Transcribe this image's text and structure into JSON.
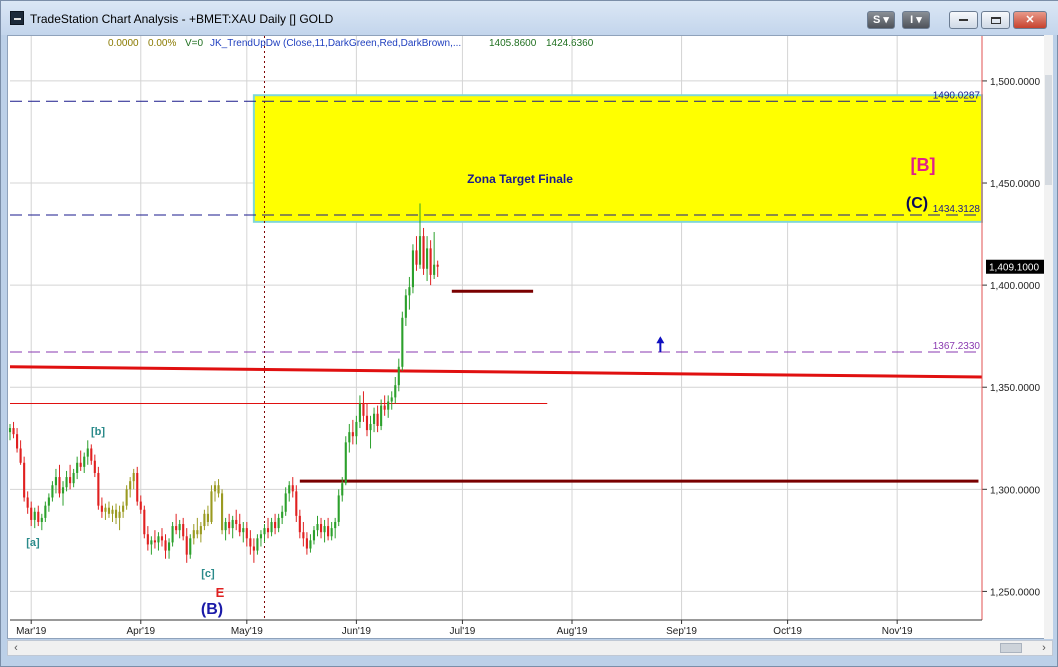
{
  "window": {
    "title": "TradeStation Chart Analysis - +BMET:XAU Daily [] GOLD",
    "buttons": {
      "s_label": "S ▾",
      "i_label": "I ▾"
    }
  },
  "indicator": {
    "v1": "0.0000",
    "v2": "0.00%",
    "v3": "V=0",
    "name": "JK_TrendUpDw (Close,11,DarkGreen,Red,DarkBrown,...",
    "v4": "1405.8600",
    "v5": "1424.6360",
    "colors": {
      "v1": "#8a7a00",
      "v3": "#1f6f1f",
      "name": "#1f3fbf",
      "values": "#1f6f1f"
    }
  },
  "annotations": {
    "zone_label": "Zona Target Finale",
    "wave_B_bracket": "[B]",
    "wave_C": "(C)",
    "wave_b": "[b]",
    "wave_a": "[a]",
    "wave_c": "[c]",
    "wave_E": "E",
    "wave_B": "(B)"
  },
  "colors": {
    "zone_fill": "#ffff00",
    "zone_border": "#7fd7d7",
    "trend_red": "#e01010",
    "support_brown": "#7a0000",
    "dash_navy": "#1a1a8c",
    "dash_purple": "#8a3ab0",
    "bull": "#2ca02c",
    "bear": "#e02020",
    "neutral": "#9a9a20",
    "arrow": "#1010c0"
  },
  "chart_data": {
    "type": "candlestick",
    "symbol": "+BMET:XAU",
    "interval": "Daily",
    "ylim": [
      1236,
      1522
    ],
    "y_ticks": [
      "1,500.0000",
      "1,450.0000",
      "1,400.0000",
      "1,350.0000",
      "1,300.0000",
      "1,250.0000"
    ],
    "y_tick_values": [
      1500,
      1450,
      1400,
      1350,
      1300,
      1250
    ],
    "x_labels": [
      "Mar'19",
      "Apr'19",
      "May'19",
      "Jun'19",
      "Jul'19",
      "Aug'19",
      "Sep'19",
      "Oct'19",
      "Nov'19"
    ],
    "x_label_days": [
      0,
      31,
      61,
      92,
      122,
      153,
      184,
      214,
      245
    ],
    "x_range_days": [
      -6,
      269
    ],
    "last_price": "1,409.1000",
    "levels": [
      {
        "name": "upper",
        "label": "1490.0287",
        "value": 1490.0287
      },
      {
        "name": "lower",
        "label": "1434.3128",
        "value": 1434.3128
      },
      {
        "name": "pivot",
        "label": "1367.2330",
        "value": 1367.233
      }
    ],
    "target_zone": {
      "low": 1431,
      "high": 1493,
      "start_day": 63,
      "label": "Zona Target Finale"
    },
    "trendline": {
      "start_day": -6,
      "start_value": 1360,
      "end_day": 269,
      "end_value": 1355
    },
    "thin_red_line": {
      "value": 1342,
      "start_day": -6,
      "end_day": 146
    },
    "support_high": {
      "value": 1304,
      "start_day": 76,
      "end_day": 268
    },
    "support_short": {
      "value": 1397,
      "start_day": 119,
      "end_day": 142
    },
    "vertical_marker_day": 66,
    "arrow": {
      "day": 178,
      "value": 1374
    },
    "candles": [
      {
        "d": -6,
        "o": 1328,
        "h": 1332,
        "l": 1324,
        "c": 1330
      },
      {
        "d": -5,
        "o": 1330,
        "h": 1333,
        "l": 1325,
        "c": 1327
      },
      {
        "d": -4,
        "o": 1327,
        "h": 1330,
        "l": 1318,
        "c": 1320
      },
      {
        "d": -3,
        "o": 1320,
        "h": 1324,
        "l": 1312,
        "c": 1313
      },
      {
        "d": -2,
        "o": 1313,
        "h": 1316,
        "l": 1294,
        "c": 1296
      },
      {
        "d": -1,
        "o": 1296,
        "h": 1299,
        "l": 1288,
        "c": 1291
      },
      {
        "d": 0,
        "o": 1291,
        "h": 1294,
        "l": 1282,
        "c": 1285
      },
      {
        "d": 1,
        "o": 1285,
        "h": 1291,
        "l": 1281,
        "c": 1289
      },
      {
        "d": 2,
        "o": 1289,
        "h": 1292,
        "l": 1282,
        "c": 1284
      },
      {
        "d": 3,
        "o": 1284,
        "h": 1288,
        "l": 1280,
        "c": 1286
      },
      {
        "d": 4,
        "o": 1286,
        "h": 1294,
        "l": 1284,
        "c": 1292
      },
      {
        "d": 5,
        "o": 1292,
        "h": 1298,
        "l": 1289,
        "c": 1296
      },
      {
        "d": 6,
        "o": 1296,
        "h": 1304,
        "l": 1294,
        "c": 1302
      },
      {
        "d": 7,
        "o": 1302,
        "h": 1310,
        "l": 1298,
        "c": 1306
      },
      {
        "d": 8,
        "o": 1306,
        "h": 1312,
        "l": 1296,
        "c": 1298
      },
      {
        "d": 9,
        "o": 1298,
        "h": 1304,
        "l": 1292,
        "c": 1301
      },
      {
        "d": 10,
        "o": 1301,
        "h": 1309,
        "l": 1299,
        "c": 1306
      },
      {
        "d": 11,
        "o": 1306,
        "h": 1312,
        "l": 1300,
        "c": 1303
      },
      {
        "d": 12,
        "o": 1303,
        "h": 1310,
        "l": 1301,
        "c": 1308
      },
      {
        "d": 13,
        "o": 1308,
        "h": 1316,
        "l": 1305,
        "c": 1313
      },
      {
        "d": 14,
        "o": 1313,
        "h": 1319,
        "l": 1309,
        "c": 1311
      },
      {
        "d": 15,
        "o": 1311,
        "h": 1318,
        "l": 1308,
        "c": 1316
      },
      {
        "d": 16,
        "o": 1316,
        "h": 1324,
        "l": 1312,
        "c": 1320
      },
      {
        "d": 17,
        "o": 1320,
        "h": 1322,
        "l": 1312,
        "c": 1314
      },
      {
        "d": 18,
        "o": 1314,
        "h": 1317,
        "l": 1306,
        "c": 1308
      },
      {
        "d": 19,
        "o": 1308,
        "h": 1311,
        "l": 1290,
        "c": 1292
      },
      {
        "d": 20,
        "o": 1292,
        "h": 1296,
        "l": 1286,
        "c": 1289
      },
      {
        "d": 21,
        "o": 1289,
        "h": 1293,
        "l": 1285,
        "c": 1291
      },
      {
        "d": 22,
        "o": 1291,
        "h": 1294,
        "l": 1286,
        "c": 1288
      },
      {
        "d": 23,
        "o": 1288,
        "h": 1292,
        "l": 1284,
        "c": 1290
      },
      {
        "d": 24,
        "o": 1290,
        "h": 1293,
        "l": 1283,
        "c": 1286
      },
      {
        "d": 25,
        "o": 1286,
        "h": 1292,
        "l": 1280,
        "c": 1289
      },
      {
        "d": 26,
        "o": 1289,
        "h": 1294,
        "l": 1286,
        "c": 1292
      },
      {
        "d": 27,
        "o": 1292,
        "h": 1302,
        "l": 1290,
        "c": 1300
      },
      {
        "d": 28,
        "o": 1300,
        "h": 1306,
        "l": 1296,
        "c": 1304
      },
      {
        "d": 29,
        "o": 1304,
        "h": 1310,
        "l": 1300,
        "c": 1308
      },
      {
        "d": 30,
        "o": 1308,
        "h": 1311,
        "l": 1292,
        "c": 1294
      },
      {
        "d": 31,
        "o": 1294,
        "h": 1297,
        "l": 1288,
        "c": 1290
      },
      {
        "d": 32,
        "o": 1290,
        "h": 1292,
        "l": 1276,
        "c": 1278
      },
      {
        "d": 33,
        "o": 1278,
        "h": 1282,
        "l": 1270,
        "c": 1273
      },
      {
        "d": 34,
        "o": 1273,
        "h": 1277,
        "l": 1268,
        "c": 1275
      },
      {
        "d": 35,
        "o": 1275,
        "h": 1280,
        "l": 1271,
        "c": 1274
      },
      {
        "d": 36,
        "o": 1274,
        "h": 1279,
        "l": 1270,
        "c": 1277
      },
      {
        "d": 37,
        "o": 1277,
        "h": 1281,
        "l": 1272,
        "c": 1275
      },
      {
        "d": 38,
        "o": 1275,
        "h": 1278,
        "l": 1266,
        "c": 1270
      },
      {
        "d": 39,
        "o": 1270,
        "h": 1276,
        "l": 1266,
        "c": 1274
      },
      {
        "d": 40,
        "o": 1274,
        "h": 1284,
        "l": 1272,
        "c": 1282
      },
      {
        "d": 41,
        "o": 1282,
        "h": 1288,
        "l": 1278,
        "c": 1280
      },
      {
        "d": 42,
        "o": 1280,
        "h": 1285,
        "l": 1276,
        "c": 1283
      },
      {
        "d": 43,
        "o": 1283,
        "h": 1286,
        "l": 1275,
        "c": 1277
      },
      {
        "d": 44,
        "o": 1277,
        "h": 1281,
        "l": 1264,
        "c": 1268
      },
      {
        "d": 45,
        "o": 1268,
        "h": 1278,
        "l": 1266,
        "c": 1276
      },
      {
        "d": 46,
        "o": 1276,
        "h": 1283,
        "l": 1273,
        "c": 1280
      },
      {
        "d": 47,
        "o": 1280,
        "h": 1286,
        "l": 1276,
        "c": 1278
      },
      {
        "d": 48,
        "o": 1278,
        "h": 1284,
        "l": 1274,
        "c": 1282
      },
      {
        "d": 49,
        "o": 1282,
        "h": 1290,
        "l": 1280,
        "c": 1288
      },
      {
        "d": 50,
        "o": 1288,
        "h": 1292,
        "l": 1282,
        "c": 1284
      },
      {
        "d": 51,
        "o": 1284,
        "h": 1302,
        "l": 1283,
        "c": 1299
      },
      {
        "d": 52,
        "o": 1299,
        "h": 1304,
        "l": 1294,
        "c": 1302
      },
      {
        "d": 53,
        "o": 1302,
        "h": 1305,
        "l": 1296,
        "c": 1298
      },
      {
        "d": 54,
        "o": 1298,
        "h": 1300,
        "l": 1278,
        "c": 1280
      },
      {
        "d": 55,
        "o": 1280,
        "h": 1286,
        "l": 1275,
        "c": 1284
      },
      {
        "d": 56,
        "o": 1284,
        "h": 1288,
        "l": 1278,
        "c": 1281
      },
      {
        "d": 57,
        "o": 1281,
        "h": 1287,
        "l": 1276,
        "c": 1285
      },
      {
        "d": 58,
        "o": 1285,
        "h": 1290,
        "l": 1280,
        "c": 1283
      },
      {
        "d": 59,
        "o": 1283,
        "h": 1288,
        "l": 1277,
        "c": 1279
      },
      {
        "d": 60,
        "o": 1279,
        "h": 1284,
        "l": 1274,
        "c": 1281
      },
      {
        "d": 61,
        "o": 1281,
        "h": 1284,
        "l": 1272,
        "c": 1276
      },
      {
        "d": 62,
        "o": 1276,
        "h": 1280,
        "l": 1268,
        "c": 1272
      },
      {
        "d": 63,
        "o": 1272,
        "h": 1276,
        "l": 1264,
        "c": 1270
      },
      {
        "d": 64,
        "o": 1270,
        "h": 1278,
        "l": 1268,
        "c": 1276
      },
      {
        "d": 65,
        "o": 1276,
        "h": 1280,
        "l": 1272,
        "c": 1278
      },
      {
        "d": 66,
        "o": 1278,
        "h": 1283,
        "l": 1274,
        "c": 1281
      },
      {
        "d": 67,
        "o": 1281,
        "h": 1286,
        "l": 1276,
        "c": 1279
      },
      {
        "d": 68,
        "o": 1279,
        "h": 1286,
        "l": 1277,
        "c": 1284
      },
      {
        "d": 69,
        "o": 1284,
        "h": 1288,
        "l": 1278,
        "c": 1281
      },
      {
        "d": 70,
        "o": 1281,
        "h": 1288,
        "l": 1279,
        "c": 1286
      },
      {
        "d": 71,
        "o": 1286,
        "h": 1292,
        "l": 1283,
        "c": 1289
      },
      {
        "d": 72,
        "o": 1289,
        "h": 1301,
        "l": 1287,
        "c": 1298
      },
      {
        "d": 73,
        "o": 1298,
        "h": 1304,
        "l": 1294,
        "c": 1302
      },
      {
        "d": 74,
        "o": 1302,
        "h": 1306,
        "l": 1296,
        "c": 1299
      },
      {
        "d": 75,
        "o": 1299,
        "h": 1302,
        "l": 1284,
        "c": 1287
      },
      {
        "d": 76,
        "o": 1287,
        "h": 1290,
        "l": 1276,
        "c": 1279
      },
      {
        "d": 77,
        "o": 1279,
        "h": 1284,
        "l": 1272,
        "c": 1276
      },
      {
        "d": 78,
        "o": 1276,
        "h": 1279,
        "l": 1268,
        "c": 1271
      },
      {
        "d": 79,
        "o": 1271,
        "h": 1278,
        "l": 1269,
        "c": 1275
      },
      {
        "d": 80,
        "o": 1275,
        "h": 1282,
        "l": 1273,
        "c": 1280
      },
      {
        "d": 81,
        "o": 1280,
        "h": 1287,
        "l": 1277,
        "c": 1283
      },
      {
        "d": 82,
        "o": 1283,
        "h": 1286,
        "l": 1276,
        "c": 1279
      },
      {
        "d": 83,
        "o": 1279,
        "h": 1285,
        "l": 1274,
        "c": 1282
      },
      {
        "d": 84,
        "o": 1282,
        "h": 1286,
        "l": 1275,
        "c": 1277
      },
      {
        "d": 85,
        "o": 1277,
        "h": 1284,
        "l": 1275,
        "c": 1281
      },
      {
        "d": 86,
        "o": 1281,
        "h": 1286,
        "l": 1276,
        "c": 1284
      },
      {
        "d": 87,
        "o": 1284,
        "h": 1300,
        "l": 1282,
        "c": 1297
      },
      {
        "d": 88,
        "o": 1297,
        "h": 1306,
        "l": 1294,
        "c": 1303
      },
      {
        "d": 89,
        "o": 1303,
        "h": 1326,
        "l": 1302,
        "c": 1323
      },
      {
        "d": 90,
        "o": 1323,
        "h": 1332,
        "l": 1318,
        "c": 1328
      },
      {
        "d": 91,
        "o": 1328,
        "h": 1334,
        "l": 1322,
        "c": 1326
      },
      {
        "d": 92,
        "o": 1326,
        "h": 1336,
        "l": 1322,
        "c": 1333
      },
      {
        "d": 93,
        "o": 1333,
        "h": 1346,
        "l": 1330,
        "c": 1342
      },
      {
        "d": 94,
        "o": 1342,
        "h": 1348,
        "l": 1333,
        "c": 1336
      },
      {
        "d": 95,
        "o": 1336,
        "h": 1342,
        "l": 1326,
        "c": 1329
      },
      {
        "d": 96,
        "o": 1329,
        "h": 1336,
        "l": 1320,
        "c": 1332
      },
      {
        "d": 97,
        "o": 1332,
        "h": 1340,
        "l": 1328,
        "c": 1337
      },
      {
        "d": 98,
        "o": 1337,
        "h": 1341,
        "l": 1328,
        "c": 1331
      },
      {
        "d": 99,
        "o": 1331,
        "h": 1344,
        "l": 1329,
        "c": 1341
      },
      {
        "d": 100,
        "o": 1341,
        "h": 1346,
        "l": 1336,
        "c": 1339
      },
      {
        "d": 101,
        "o": 1339,
        "h": 1346,
        "l": 1335,
        "c": 1343
      },
      {
        "d": 102,
        "o": 1343,
        "h": 1348,
        "l": 1339,
        "c": 1345
      },
      {
        "d": 103,
        "o": 1345,
        "h": 1355,
        "l": 1342,
        "c": 1351
      },
      {
        "d": 104,
        "o": 1351,
        "h": 1364,
        "l": 1348,
        "c": 1360
      },
      {
        "d": 105,
        "o": 1360,
        "h": 1387,
        "l": 1358,
        "c": 1384
      },
      {
        "d": 106,
        "o": 1384,
        "h": 1398,
        "l": 1380,
        "c": 1395
      },
      {
        "d": 107,
        "o": 1395,
        "h": 1404,
        "l": 1388,
        "c": 1399
      },
      {
        "d": 108,
        "o": 1399,
        "h": 1420,
        "l": 1396,
        "c": 1417
      },
      {
        "d": 109,
        "o": 1417,
        "h": 1424,
        "l": 1407,
        "c": 1410
      },
      {
        "d": 110,
        "o": 1410,
        "h": 1440,
        "l": 1408,
        "c": 1424
      },
      {
        "d": 111,
        "o": 1424,
        "h": 1428,
        "l": 1405,
        "c": 1408
      },
      {
        "d": 112,
        "o": 1408,
        "h": 1424,
        "l": 1402,
        "c": 1418
      },
      {
        "d": 113,
        "o": 1418,
        "h": 1422,
        "l": 1400,
        "c": 1405
      },
      {
        "d": 114,
        "o": 1405,
        "h": 1426,
        "l": 1403,
        "c": 1410
      },
      {
        "d": 115,
        "o": 1410,
        "h": 1412,
        "l": 1404,
        "c": 1409
      }
    ]
  }
}
